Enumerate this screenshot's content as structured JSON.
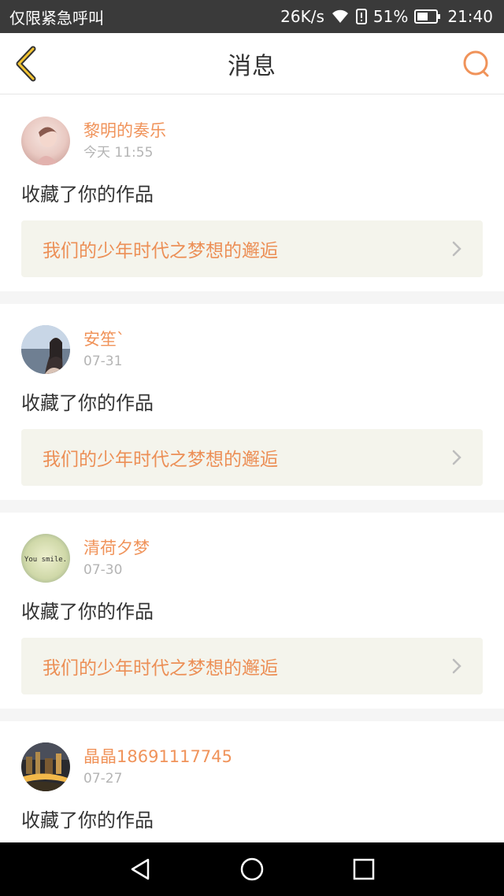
{
  "status_bar": {
    "carrier_text": "仅限紧急呼叫",
    "net_speed": "26K/s",
    "battery_pct": "51%",
    "time": "21:40"
  },
  "header": {
    "title": "消息"
  },
  "messages": [
    {
      "user": "黎明的奏乐",
      "time": "今天 11:55",
      "action": "收藏了你的作品",
      "work": "我们的少年时代之梦想的邂逅"
    },
    {
      "user": "安笙`",
      "time": "07-31",
      "action": "收藏了你的作品",
      "work": "我们的少年时代之梦想的邂逅"
    },
    {
      "user": "清荷夕梦",
      "time": "07-30",
      "action": "收藏了你的作品",
      "work": "我们的少年时代之梦想的邂逅",
      "avatar_text": "You smile."
    },
    {
      "user": "晶晶18691117745",
      "time": "07-27",
      "action": "收藏了你的作品"
    }
  ],
  "colors": {
    "accent": "#f0935a",
    "work_bg": "#f4f4ec",
    "status_bg": "#3a3a3a"
  }
}
